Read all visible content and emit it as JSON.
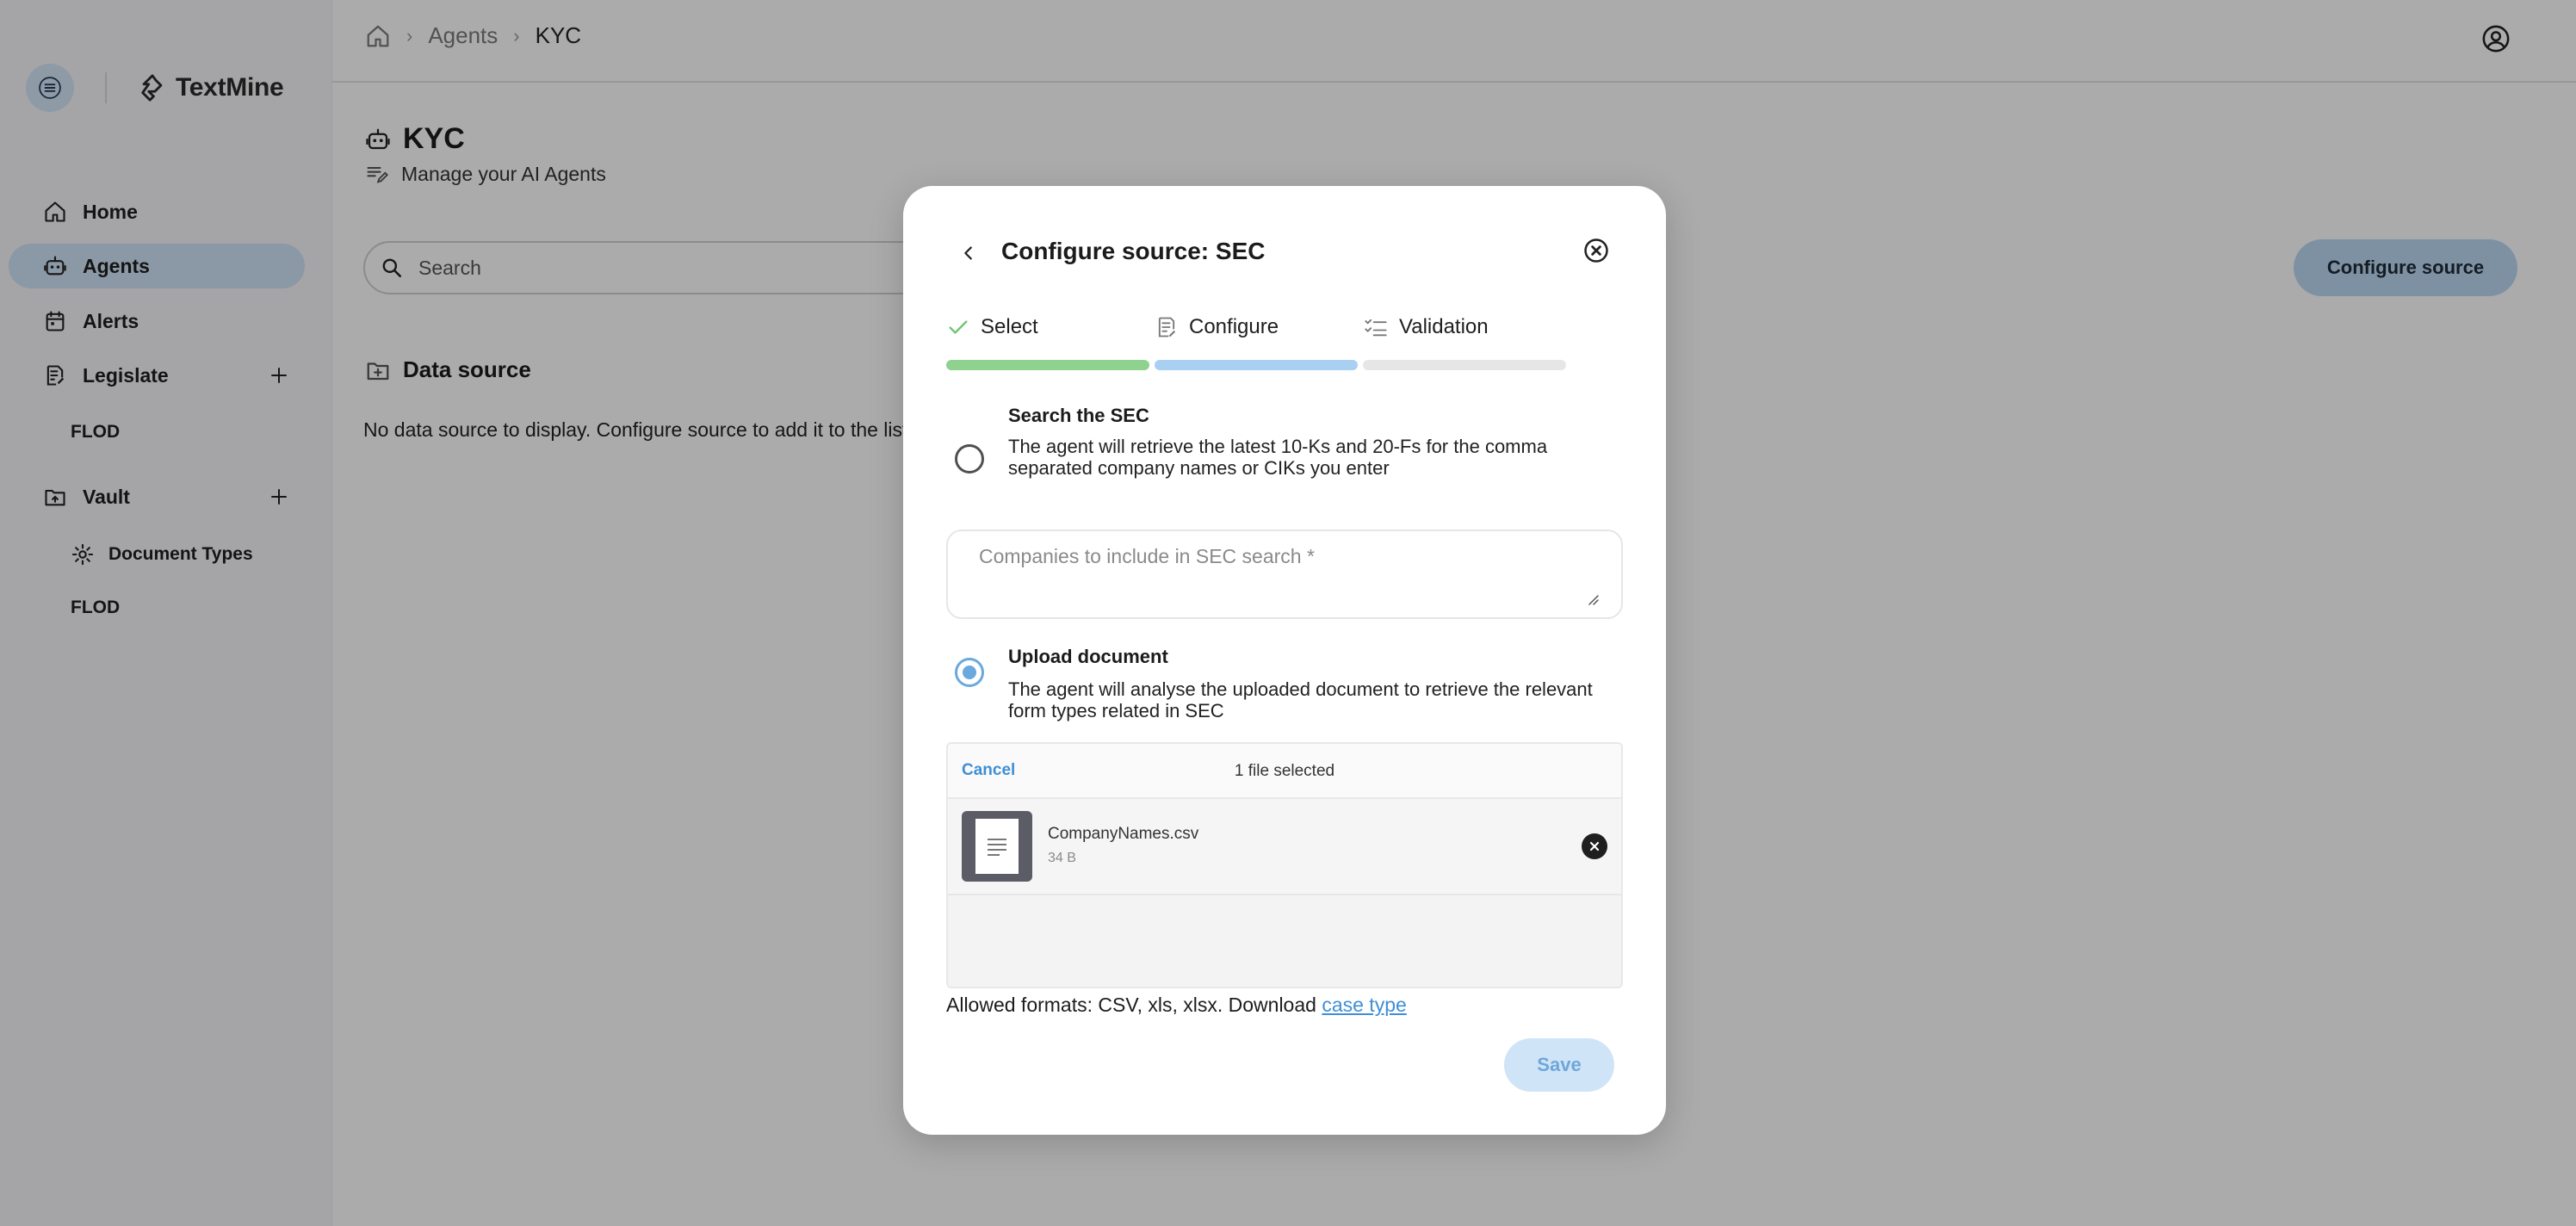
{
  "app": {
    "brand_name": "TextMine"
  },
  "breadcrumb": {
    "items": [
      "Agents",
      "KYC"
    ]
  },
  "sidebar": {
    "items": [
      {
        "label": "Home"
      },
      {
        "label": "Agents"
      },
      {
        "label": "Alerts"
      },
      {
        "label": "Legislate"
      },
      {
        "label": "FLOD"
      },
      {
        "label": "Vault"
      },
      {
        "label": "Document Types"
      },
      {
        "label": "FLOD"
      }
    ]
  },
  "page": {
    "title": "KYC",
    "subtitle": "Manage your AI Agents",
    "search_placeholder": "Search",
    "configure_button": "Configure source",
    "data_source_title": "Data source",
    "empty_message": "No data source to display. Configure source to add it to the list"
  },
  "modal": {
    "title": "Configure source: SEC",
    "steps": [
      {
        "label": "Select",
        "status": "done"
      },
      {
        "label": "Configure",
        "status": "current"
      },
      {
        "label": "Validation",
        "status": "pending"
      }
    ],
    "options": [
      {
        "title": "Search the SEC",
        "description": "The agent will retrieve the latest 10-Ks and 20-Fs for the comma separated company names or CIKs you enter",
        "selected": false
      },
      {
        "title": "Upload document",
        "description": "The agent will analyse the uploaded document to retrieve the relevant form types related in SEC",
        "selected": true
      }
    ],
    "companies_placeholder": "Companies to include in SEC search *",
    "upload": {
      "cancel_label": "Cancel",
      "count_label": "1 file selected",
      "file_name": "CompanyNames.csv",
      "file_size": "34 B"
    },
    "allowed_text": "Allowed formats: CSV, xls, xlsx. Download",
    "allowed_link": "case type",
    "save_label": "Save"
  },
  "colors": {
    "accent": "#3f8fd6",
    "active_nav": "#cfe3f6",
    "step_done": "#8fd18f",
    "step_current": "#a9d0f2",
    "step_pending": "#e6e6e6",
    "overlay": "rgba(0,0,0,0.33)"
  }
}
